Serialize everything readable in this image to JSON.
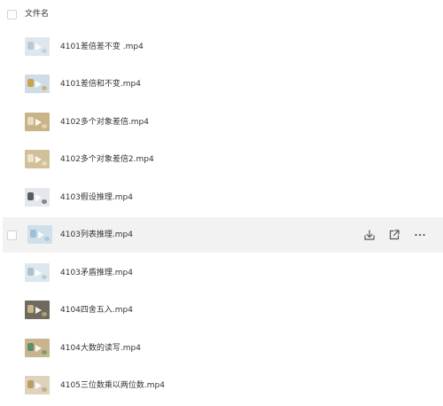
{
  "header": {
    "column_label": "文件名"
  },
  "files": [
    {
      "name": "4101差倍差不变 .mp4",
      "thumb_color": "#dfe7ee",
      "accent_color": "#b8c8d6"
    },
    {
      "name": "4101差倍和不变.mp4",
      "thumb_color": "#cfdbe6",
      "accent_color": "#c9a24a"
    },
    {
      "name": "4102多个对象差倍.mp4",
      "thumb_color": "#c9b48a",
      "accent_color": "#e9dcc0"
    },
    {
      "name": "4102多个对象差倍2.mp4",
      "thumb_color": "#d2c09a",
      "accent_color": "#efe3c8"
    },
    {
      "name": "4103假设推理.mp4",
      "thumb_color": "#e4e8ec",
      "accent_color": "#555d66"
    },
    {
      "name": "4103列表推理.mp4",
      "thumb_color": "#cfe0ea",
      "accent_color": "#9fbfd3"
    },
    {
      "name": "4103矛盾推理.mp4",
      "thumb_color": "#dde8ee",
      "accent_color": "#a9c3d2"
    },
    {
      "name": "4104四舍五入.mp4",
      "thumb_color": "#6f6a5e",
      "accent_color": "#c7b48a"
    },
    {
      "name": "4104大数的读写.mp4",
      "thumb_color": "#c8b58e",
      "accent_color": "#5d8f6a"
    },
    {
      "name": "4105三位数乘以两位数.mp4",
      "thumb_color": "#ddd3bd",
      "accent_color": "#b89d6a"
    }
  ],
  "hovered_row": {
    "index": 5,
    "actions": [
      {
        "icon": "download-icon",
        "label": "下载"
      },
      {
        "icon": "share-icon",
        "label": "分享"
      },
      {
        "icon": "more-icon",
        "label": "更多"
      }
    ]
  },
  "colors": {
    "hover_background": "#f2f2f2",
    "text": "#333333",
    "icon": "#555555"
  }
}
